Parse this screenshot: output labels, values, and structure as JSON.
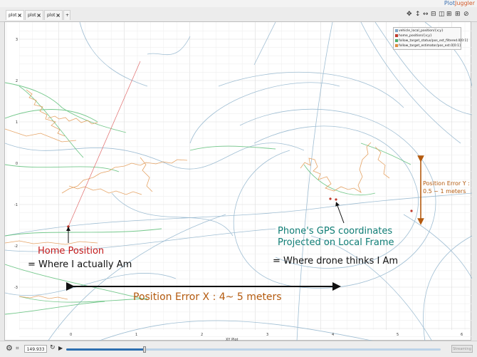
{
  "app": {
    "brand_a": "Plot",
    "brand_b": "Juggler"
  },
  "tabs": [
    {
      "label": "plot"
    },
    {
      "label": "plot"
    },
    {
      "label": "plot"
    }
  ],
  "toolbar": {
    "icons": [
      "move-icon",
      "fit-vertical-icon",
      "fit-horizontal-icon",
      "split-horizontal-icon",
      "split-vertical-icon",
      "grid-icon",
      "link-icon"
    ]
  },
  "plot": {
    "xaxis_label": "XY Plot",
    "x_ticks": [
      "0",
      "1",
      "2",
      "3",
      "4",
      "5",
      "6"
    ],
    "y_ticks": [
      "3",
      "2",
      "1",
      "0",
      "-1",
      "-2",
      "-3"
    ],
    "legend": [
      {
        "label": "vehicle_local_position/{x;y}",
        "color": "#7fa7c7"
      },
      {
        "label": "home_position/{x;y}",
        "color": "#c0392b"
      },
      {
        "label": "follow_target_status/pos_est_filtered.0[0:1]",
        "color": "#4caf6a"
      },
      {
        "label": "follow_target_estimator/pos_est.0[0:1]",
        "color": "#e08a3c"
      }
    ]
  },
  "annotations": {
    "home_position": "Home Position",
    "where_actually": "= Where I actually Am",
    "phone_gps_line1": "Phone's GPS coordinates",
    "phone_gps_line2": "Projected on Local Frame",
    "where_drone_thinks": "= Where drone thinks I Am",
    "pos_error_x": "Position Error X : 4~ 5 meters",
    "pos_error_y_line1": "Position Error Y :",
    "pos_error_y_line2": "0.5 ~ 1 meters"
  },
  "colors": {
    "home_red": "#c41a1a",
    "teal": "#0f7d75",
    "orange": "#b45a0e"
  },
  "statusbar": {
    "time_value": "149.933",
    "streaming_label": "Streaming"
  }
}
